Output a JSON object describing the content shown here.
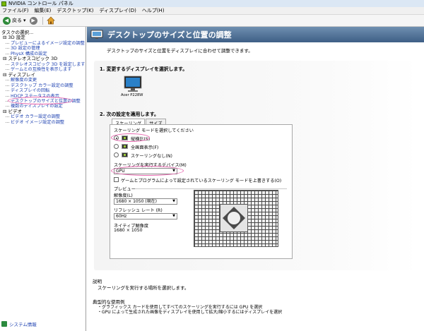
{
  "window": {
    "title": "NVIDIA コントロール パネル"
  },
  "menu": [
    "ファイル(F)",
    "編集(E)",
    "デスクトップ(K)",
    "ディスプレイ(D)",
    "ヘルプ(H)"
  ],
  "toolbar": {
    "back_label": "戻る"
  },
  "sidebar": {
    "heading": "タスクの選択...",
    "categories": [
      {
        "label": "3D 設定",
        "items": [
          "プレビューによるイメージ設定の調整",
          "3D 設定の管理",
          "PhysX 構成の設定"
        ]
      },
      {
        "label": "ステレオスコピック 3D",
        "items": [
          "ステレオスコピック 3D を設定します",
          "ゲームとの互換性を表示します"
        ]
      },
      {
        "label": "ディスプレイ",
        "items": [
          "解像度の変更",
          "デスクトップ カラー設定の調整",
          "ディスプレイの回転",
          "HDCP ステータスの表示",
          "デスクトップのサイズと位置の調整",
          "複数のディスプレイの設定"
        ]
      },
      {
        "label": "ビデオ",
        "items": [
          "ビデオ カラー設定の調整",
          "ビデオ イメージ設定の調整"
        ]
      }
    ],
    "system_info": "システム情報"
  },
  "page": {
    "title": "デスクトップのサイズと位置の調整",
    "description": "デスクトップのサイズと位置をディスプレイに合わせて調整できます。",
    "step1": "1. 変更するディスプレイを選択します。",
    "display_name": "Acer P228W",
    "step2": "2. 次の設定を適用します。",
    "tabs": [
      "スケーリング",
      "サイズ"
    ],
    "scaling_mode_label": "スケーリング モードを選択してください",
    "modes": [
      "縦横比(S)",
      "全画面表示(F)",
      "スケーリングなし(N)"
    ],
    "selected_mode_index": 0,
    "device_label": "スケーリングを実行するデバイス(M)",
    "device_value": "GPU",
    "override_checkbox": "ゲームとプログラムによって設定されているスケーリング モードを上書きする(O)",
    "override_checked": false,
    "preview_label": "プレビュー",
    "resolution_label": "解像度(L)",
    "resolution_value": "1680 × 1050 (現在)",
    "refresh_label": "リフレッシュ レート (R)",
    "refresh_value": "60Hz",
    "native_label": "ネイティブ解像度",
    "native_value": "1680 × 1050",
    "explanation_heading": "説明",
    "explanation_text": "スケーリングを実行する場所を選択します。",
    "usage_heading": "典型的な使用例",
    "usage_items": [
      "・グラフィックス カードを使用してすべてのスケーリングを実行するには GPU を選択",
      "・GPU によって生成された画像をディスプレイを使用して拡大/縮小するにはディスプレイを選択"
    ]
  },
  "colors": {
    "banner": "#4d6d92",
    "link": "#1b3fb0",
    "highlight": "#e868b0"
  }
}
